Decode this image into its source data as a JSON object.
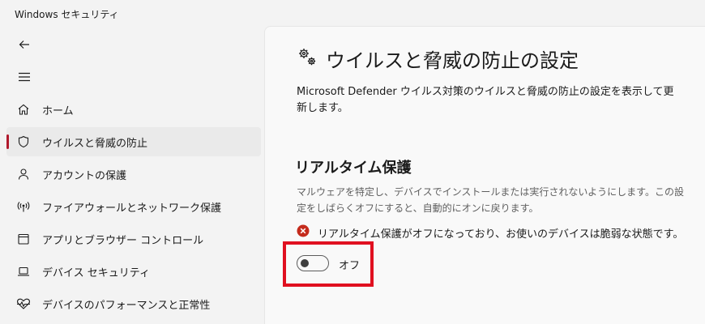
{
  "window": {
    "title": "Windows セキュリティ"
  },
  "nav": {
    "back_icon": "back-arrow-icon",
    "menu_icon": "hamburger-menu-icon"
  },
  "sidebar": {
    "accent_color": "#b0192c",
    "items": [
      {
        "label": "ホーム",
        "icon": "home-icon",
        "active": false
      },
      {
        "label": "ウイルスと脅威の防止",
        "icon": "shield-icon",
        "active": true
      },
      {
        "label": "アカウントの保護",
        "icon": "person-icon",
        "active": false
      },
      {
        "label": "ファイアウォールとネットワーク保護",
        "icon": "wireless-antenna-icon",
        "active": false
      },
      {
        "label": "アプリとブラウザー コントロール",
        "icon": "app-window-icon",
        "active": false
      },
      {
        "label": "デバイス セキュリティ",
        "icon": "laptop-icon",
        "active": false
      },
      {
        "label": "デバイスのパフォーマンスと正常性",
        "icon": "heart-pulse-icon",
        "active": false
      }
    ]
  },
  "main": {
    "heading_icon": "gears-icon",
    "title": "ウイルスと脅威の防止の設定",
    "description": "Microsoft Defender ウイルス対策のウイルスと脅威の防止の設定を表示して更新します。",
    "section": {
      "title": "リアルタイム保護",
      "description": "マルウェアを特定し、デバイスでインストールまたは実行されないようにします。この設定をしばらくオフにすると、自動的にオンに戻ります。",
      "warning_icon": "error-circle-icon",
      "warning_color": "#c42b1c",
      "warning_text": "リアルタイム保護がオフになっており、お使いのデバイスは脆弱な状態です。",
      "toggle": {
        "state": "off",
        "label": "オフ"
      }
    }
  },
  "highlight_color": "#e01020"
}
